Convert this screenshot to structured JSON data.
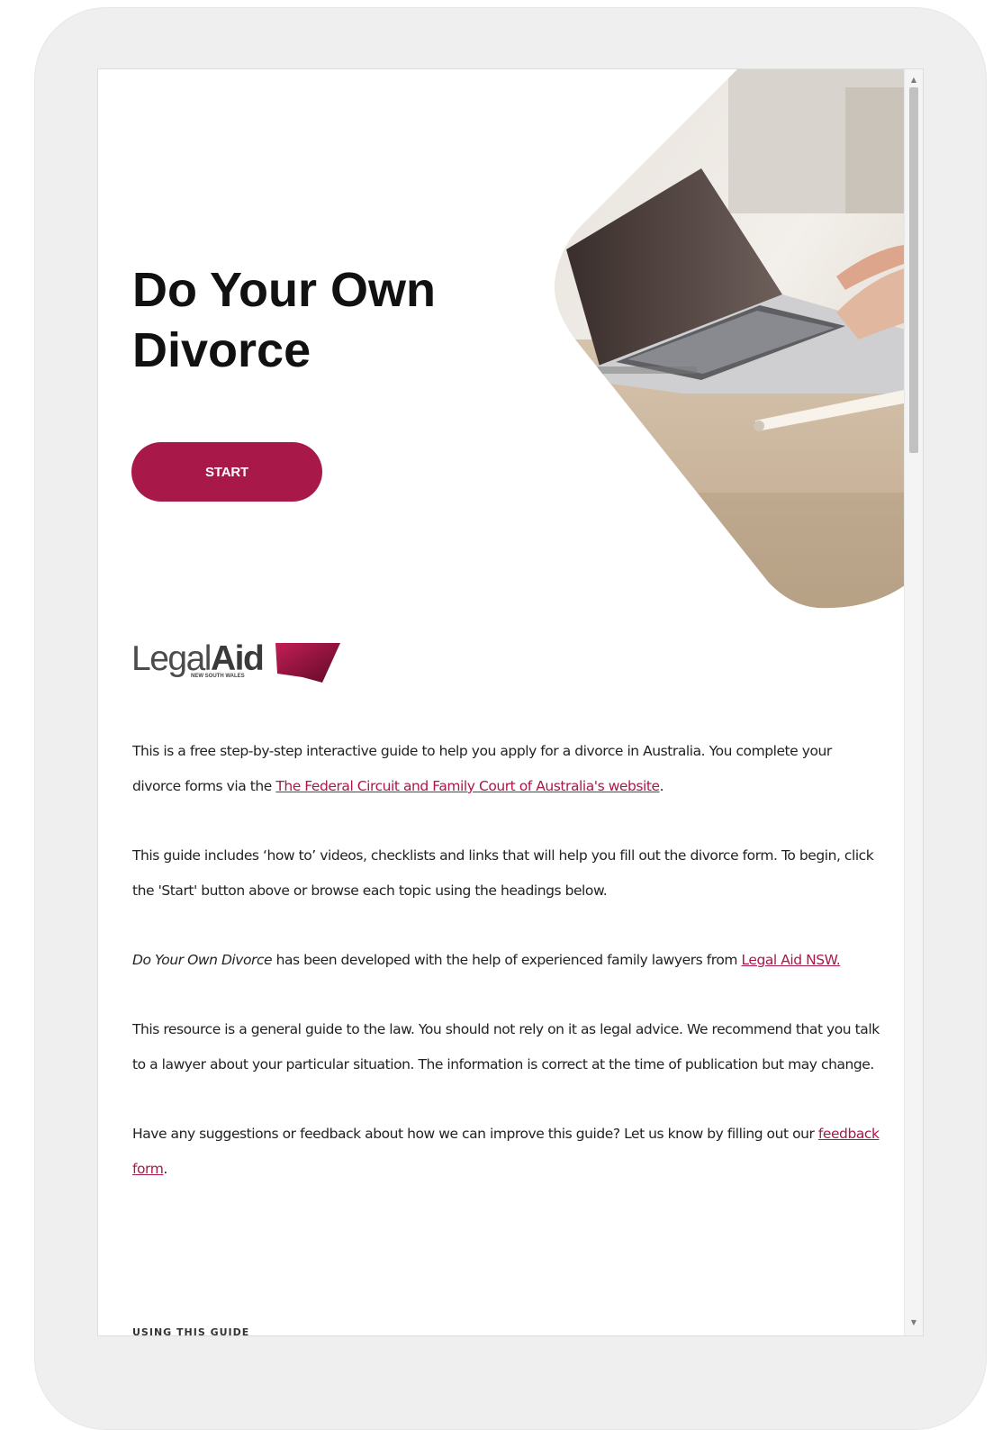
{
  "page": {
    "title_line1": "Do Your Own",
    "title_line2": "Divorce",
    "start_label": "START"
  },
  "logo": {
    "word1": "Legal",
    "word2": "Aid",
    "subtitle": "NEW SOUTH WALES"
  },
  "paragraphs": {
    "p1_text": "This is a free step-by-step interactive guide to help you apply for a divorce in Australia. You complete your divorce forms via the ",
    "p1_link": "The Federal Circuit and Family Court of Australia's website",
    "p1_end": ".",
    "p2_text": "This guide includes ‘how to’ videos, checklists and links that will help you fill out the divorce form. To begin, click the 'Start' button above or browse each topic using the headings below.",
    "p3_em": "Do Your Own Divorce",
    "p3_text": " has been developed with the help of experienced family lawyers from ",
    "p3_link": "Legal Aid NSW.",
    "p4_text": "This resource is a general guide to the law. You should not rely on it as legal advice. We recommend that you talk to a lawyer about your particular situation. The information is correct at the time of publication but may change.",
    "p5_text": "Have any suggestions or feedback about how we can improve this guide? Let us know by filling out our ",
    "p5_link": "feedback form",
    "p5_end": "."
  },
  "next_section": "USING THIS GUIDE",
  "colors": {
    "accent": "#a8194a",
    "frame": "#efefef",
    "text": "#222222"
  },
  "icons": {
    "scroll_up": "▲",
    "scroll_down": "▼"
  }
}
